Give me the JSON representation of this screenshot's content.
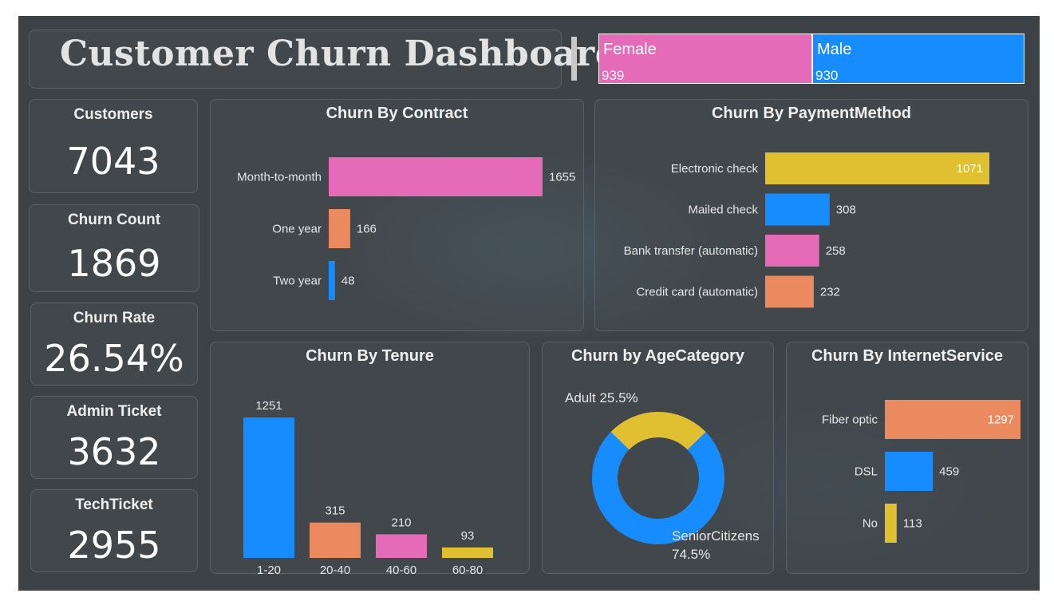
{
  "header": {
    "title": "Customer Churn Dashboard"
  },
  "gender": {
    "female": {
      "label": "Female",
      "value": "939",
      "color": "#e56ab8"
    },
    "male": {
      "label": "Male",
      "value": "930",
      "color": "#168cff"
    }
  },
  "kpis": {
    "customers": {
      "label": "Customers",
      "value": "7043"
    },
    "churn_count": {
      "label": "Churn Count",
      "value": "1869"
    },
    "churn_rate": {
      "label": "Churn Rate",
      "value": "26.54%"
    },
    "admin_ticket": {
      "label": "Admin Ticket",
      "value": "3632"
    },
    "tech_ticket": {
      "label": "TechTicket",
      "value": "2955"
    }
  },
  "charts": {
    "contract": {
      "title": "Churn By Contract"
    },
    "payment": {
      "title": "Churn By PaymentMethod"
    },
    "tenure": {
      "title": "Churn By Tenure"
    },
    "age": {
      "title": "Churn by AgeCategory"
    },
    "internet": {
      "title": "Churn By InternetService"
    }
  },
  "chart_data": [
    {
      "id": "contract",
      "type": "bar",
      "orientation": "horizontal",
      "categories": [
        "Month-to-month",
        "One year",
        "Two year"
      ],
      "values": [
        1655,
        166,
        48
      ],
      "colors": [
        "#e56ab8",
        "#ea8a5e",
        "#168cff"
      ],
      "title": "Churn By Contract"
    },
    {
      "id": "payment",
      "type": "bar",
      "orientation": "horizontal",
      "categories": [
        "Electronic check",
        "Mailed check",
        "Bank transfer (automatic)",
        "Credit card (automatic)"
      ],
      "values": [
        1071,
        308,
        258,
        232
      ],
      "colors": [
        "#e0c030",
        "#168cff",
        "#e56ab8",
        "#ea8a5e"
      ],
      "title": "Churn By PaymentMethod"
    },
    {
      "id": "tenure",
      "type": "bar",
      "orientation": "vertical",
      "categories": [
        "1-20",
        "20-40",
        "40-60",
        "60-80"
      ],
      "values": [
        1251,
        315,
        210,
        93
      ],
      "colors": [
        "#168cff",
        "#ea8a5e",
        "#e56ab8",
        "#e0c030"
      ],
      "title": "Churn By Tenure"
    },
    {
      "id": "age",
      "type": "pie",
      "donut": true,
      "categories": [
        "Adult",
        "SeniorCitizens"
      ],
      "values": [
        25.5,
        74.5
      ],
      "labels": [
        "Adult 25.5%",
        "SeniorCitizens",
        "74.5%"
      ],
      "colors": [
        "#e0c030",
        "#168cff"
      ],
      "title": "Churn by AgeCategory"
    },
    {
      "id": "internet",
      "type": "bar",
      "orientation": "horizontal",
      "categories": [
        "Fiber optic",
        "DSL",
        "No"
      ],
      "values": [
        1297,
        459,
        113
      ],
      "colors": [
        "#ea8a5e",
        "#168cff",
        "#e0c030"
      ],
      "title": "Churn By InternetService"
    }
  ]
}
